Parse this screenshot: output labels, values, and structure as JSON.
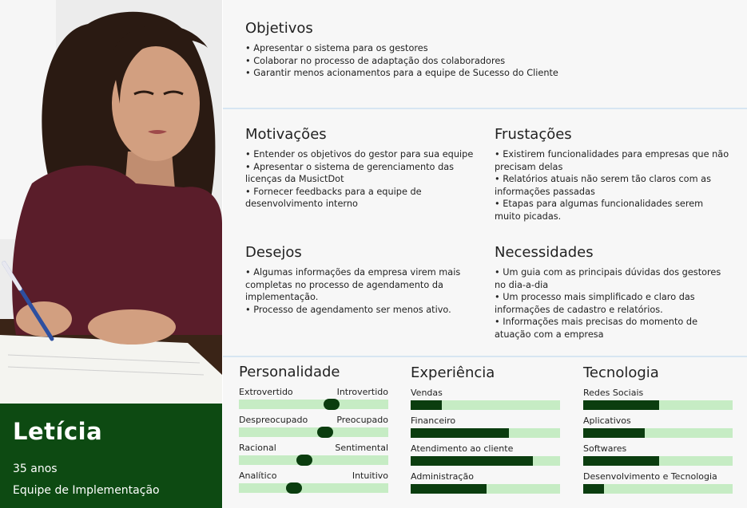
{
  "persona": {
    "name": "Letícia",
    "age": "35 anos",
    "team": "Equipe de Implementação"
  },
  "objetivos": {
    "title": "Objetivos",
    "items": [
      "Apresentar o sistema para os gestores",
      "Colaborar no processo de adaptação dos colaboradores",
      "Garantir menos acionamentos para a equipe de Sucesso do Cliente"
    ]
  },
  "motivacoes": {
    "title": "Motivações",
    "items": [
      "Entender os objetivos do gestor para sua equipe",
      "Apresentar o sistema de gerenciamento das licenças da MusictDot",
      "Fornecer feedbacks para a equipe de desenvolvimento interno"
    ]
  },
  "frustacoes": {
    "title": "Frustações",
    "items": [
      "Existirem funcionalidades para empresas que não precisam delas",
      "Relatórios atuais não serem tão claros com as informações passadas",
      "Etapas para algumas funcionalidades serem muito picadas."
    ]
  },
  "desejos": {
    "title": "Desejos",
    "items": [
      "Algumas informações da empresa virem mais completas no processo de agendamento da implementação.",
      "Processo de agendamento ser menos ativo."
    ]
  },
  "necessidades": {
    "title": "Necessidades",
    "items": [
      "Um guia com as principais dúvidas dos gestores no dia-a-dia",
      "Um processo mais simplificado e claro das informações de cadastro e relatórios.",
      "Informações mais precisas do momento de atuação com a empresa"
    ]
  },
  "personalidade": {
    "title": "Personalidade",
    "scales": [
      {
        "left": "Extrovertido",
        "right": "Introvertido",
        "value": 0.62
      },
      {
        "left": "Despreocupado",
        "right": "Preocupado",
        "value": 0.58
      },
      {
        "left": "Racional",
        "right": "Sentimental",
        "value": 0.44
      },
      {
        "left": "Analítico",
        "right": "Intuitivo",
        "value": 0.37
      }
    ]
  },
  "experiencia": {
    "title": "Experiência",
    "bars": [
      {
        "label": "Vendas",
        "value": 0.21
      },
      {
        "label": "Financeiro",
        "value": 0.66
      },
      {
        "label": "Atendimento ao cliente",
        "value": 0.82
      },
      {
        "label": "Administração",
        "value": 0.51
      }
    ]
  },
  "tecnologia": {
    "title": "Tecnologia",
    "bars": [
      {
        "label": "Redes Sociais",
        "value": 0.51
      },
      {
        "label": "Aplicativos",
        "value": 0.41
      },
      {
        "label": "Softwares",
        "value": 0.51
      },
      {
        "label": "Desenvolvimento e Tecnologia",
        "value": 0.14
      }
    ]
  },
  "colors": {
    "brand_green": "#0d4a12",
    "bar_fill": "#0b3d0f",
    "bar_track": "#c6ecc4"
  }
}
